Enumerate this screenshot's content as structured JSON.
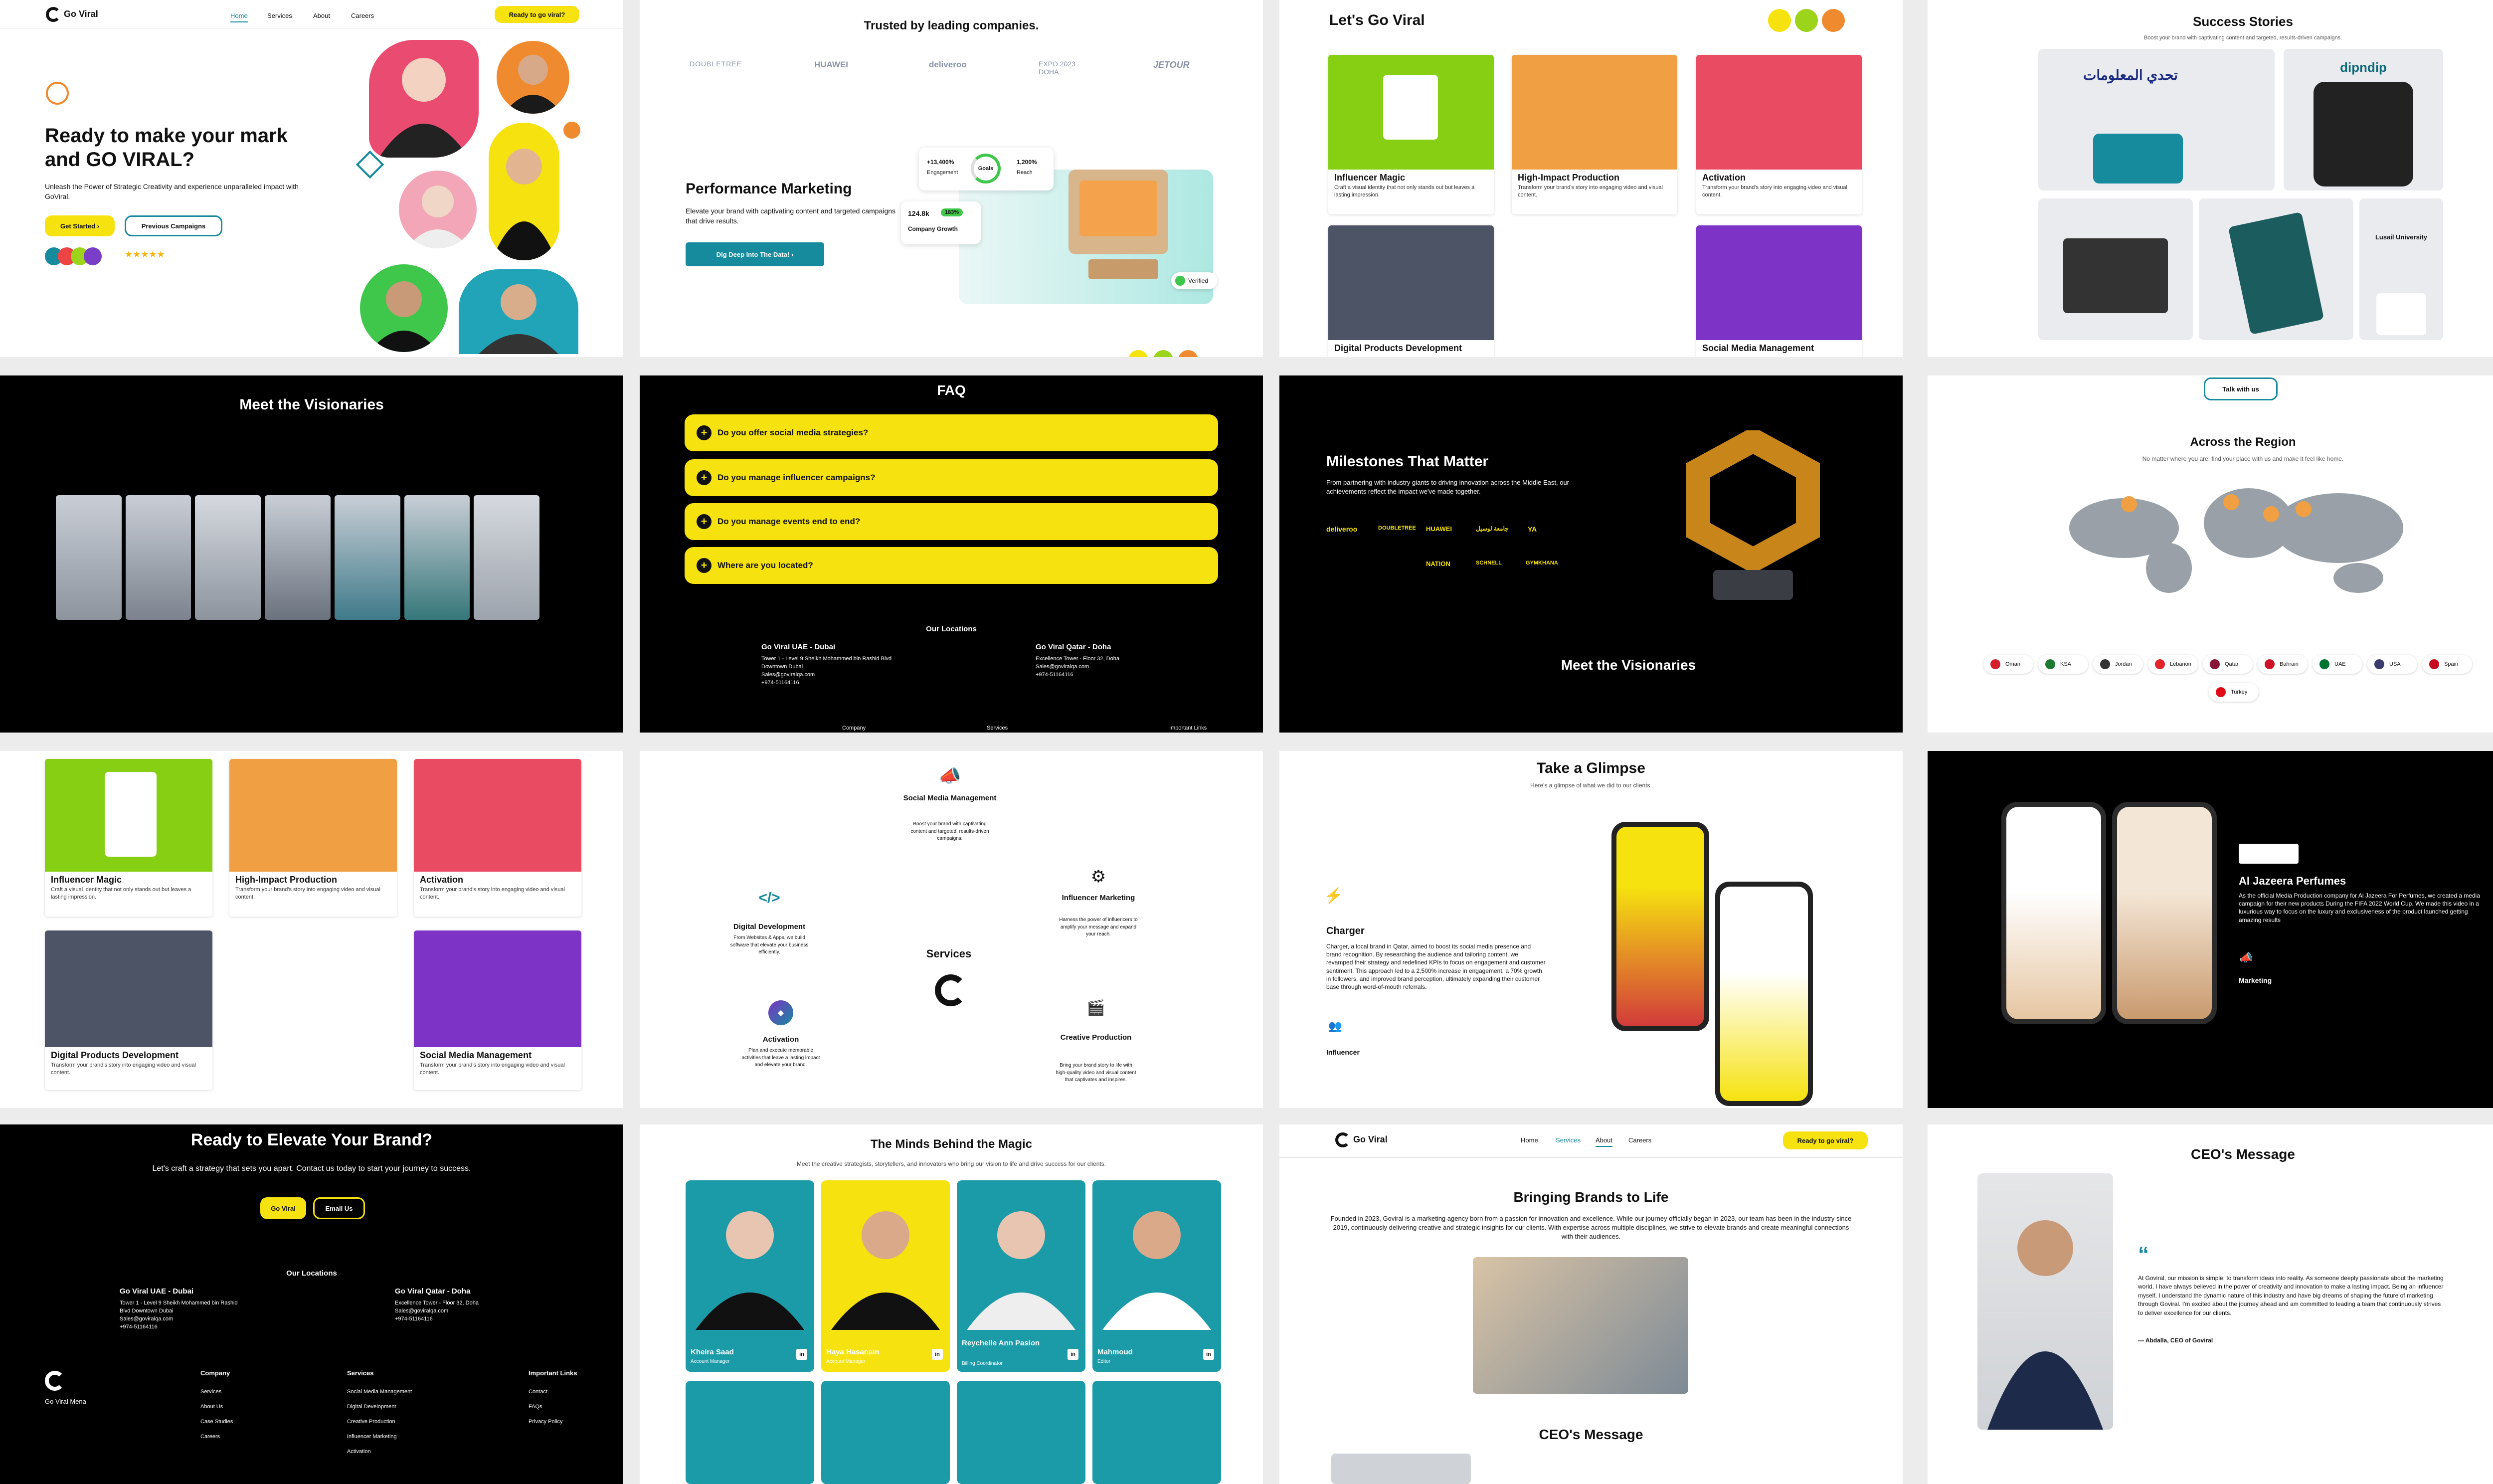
{
  "p1": {
    "brand": "Go Viral",
    "nav": [
      "Home",
      "Services",
      "About",
      "Careers"
    ],
    "cta": "Ready to go viral?",
    "h1": "Ready to make your mark and GO VIRAL?",
    "sub": "Unleash the Power of Strategic Creativity and experience unparalleled impact with GoViral.",
    "get_started": "Get Started",
    "prev": "Previous Campaigns",
    "stars": "★★★★★"
  },
  "p2": {
    "trusted": "Trusted by leading companies.",
    "logos": [
      "DOUBLETREE",
      "HUAWEI",
      "deliveroo",
      "EXPO 2023 DOHA",
      "JETOUR"
    ],
    "title": "Performance Marketing",
    "desc": "Elevate your brand with captivating content and targeted campaigns that drive results.",
    "btn": "Dig Deep Into The Data!",
    "goals": "Goals",
    "eng_val": "+13,400%",
    "eng": "Engagement",
    "reach_val": "1,200%",
    "reach": "Reach",
    "growth_val": "124.8k",
    "growth_badge": "183%",
    "growth": "Company Growth",
    "verified": "Verified"
  },
  "p3": {
    "title": "Let's Go Viral",
    "cards": [
      {
        "t": "Influencer Magic",
        "d": "Craft a visual identity that not only stands out but leaves a lasting impression."
      },
      {
        "t": "High-Impact Production",
        "d": "Transform your brand's story into engaging video and visual content."
      },
      {
        "t": "Activation",
        "d": "Transform your brand's story into engaging video and visual content."
      },
      {
        "t": "Digital Products Development",
        "d": ""
      },
      {
        "t": "Social Media Management",
        "d": ""
      }
    ]
  },
  "p4": {
    "title": "Success Stories",
    "sub": "Boost your brand with captivating content and targeted, results-driven campaigns.",
    "case1": "تحدي المعلومات",
    "case2": "dipndip",
    "case3": "Lusail University"
  },
  "p5": {
    "title": "Meet the Visionaries"
  },
  "p6": {
    "title": "FAQ",
    "q": [
      "Do you offer social media strategies?",
      "Do you manage influencer campaigns?",
      "Do you manage events end to end?",
      "Where are you located?"
    ],
    "loc": "Our Locations",
    "uae": "Go Viral UAE - Dubai",
    "uae_addr": "Tower 1 - Level 9 Sheikh Mohammed bin Rashid Blvd Downtown Dubai",
    "qat": "Go Viral Qatar - Doha",
    "qat_addr": "Excellence Tower - Floor 32, Doha",
    "email": "Sales@goviralqa.com",
    "phone": "+974-51164116",
    "f1": "Company",
    "f2": "Services",
    "f3": "Important Links"
  },
  "p7": {
    "title": "Milestones That Matter",
    "desc": "From partnering with industry giants to driving innovation across the Middle East, our achievements reflect the impact we've made together.",
    "logos": [
      "deliveroo",
      "DOUBLETREE",
      "HUAWEI",
      "جامعة لوسيل",
      "YA",
      "NATION",
      "SCHNELL",
      "GYMKHANA"
    ],
    "foot": "Meet the Visionaries"
  },
  "p8": {
    "talk": "Talk with us",
    "title": "Across the Region",
    "sub": "No matter where you are, find your place with us and make it feel like home.",
    "flags": [
      "Oman",
      "KSA",
      "Jordan",
      "Lebanon",
      "Qatar",
      "Bahrain",
      "UAE",
      "USA",
      "Spain",
      "Turkey"
    ]
  },
  "p9": {
    "cards": [
      {
        "t": "Influencer Magic",
        "d": "Craft a visual identity that not only stands out but leaves a lasting impression."
      },
      {
        "t": "High-Impact Production",
        "d": "Transform your brand's story into engaging video and visual content."
      },
      {
        "t": "Activation",
        "d": "Transform your brand's story into engaging video and visual content."
      },
      {
        "t": "Digital Products Development",
        "d": "Transform your brand's story into engaging video and visual content."
      },
      {
        "t": "Social Media Management",
        "d": "Transform your brand's story into engaging video and visual content."
      }
    ]
  },
  "p10": {
    "center": "Services",
    "items": [
      {
        "t": "Social Media Management",
        "d": "Boost your brand with captivating content and targeted, results-driven campaigns."
      },
      {
        "t": "Digital Development",
        "d": "From Websites & Apps, we build software that elevate your business efficiently."
      },
      {
        "t": "Influencer Marketing",
        "d": "Harness the power of influencers to amplify your message and expand your reach."
      },
      {
        "t": "Activation",
        "d": "Plan and execute memorable activities that leave a lasting impact and elevate your brand."
      },
      {
        "t": "Creative Production",
        "d": "Bring your brand story to life with high-quality video and visual content that captivates and inspires."
      }
    ]
  },
  "p11": {
    "title": "Take a Glimpse",
    "sub": "Here's a glimpse of what we did to our clients.",
    "brand": "Charger",
    "desc": "Charger, a local brand in Qatar, aimed to boost its social media presence and brand recognition. By researching the audience and tailoring content, we revamped their strategy and redefined KPIs to focus on engagement and customer sentiment. This approach led to a 2,500% increase in engagement, a 70% growth in followers, and improved brand perception, ultimately expanding their customer base through word-of-mouth referrals.",
    "tag": "Influencer"
  },
  "p12": {
    "title": "Al Jazeera Perfumes",
    "desc": "As the official Media Production company for Al Jazeera For Perfumes, we created a media campaign for their new products During the FIFA 2022 World Cup. We made this video in a luxurious way to focus on the luxury and exclusiveness of the product launched getting amazing results",
    "tag": "Marketing"
  },
  "p13": {
    "title": "Ready to Elevate Your Brand?",
    "sub": "Let's craft a strategy that sets you apart. Contact us today to start your journey to success.",
    "b1": "Go Viral",
    "b2": "Email Us",
    "loc": "Our Locations",
    "uae": "Go Viral UAE - Dubai",
    "uae_addr": "Tower 1 - Level 9 Sheikh Mohammed bin Rashid Blvd Downtown Dubai",
    "qat": "Go Viral Qatar - Doha",
    "qat_addr": "Excellence Tower - Floor 32, Doha",
    "email": "Sales@goviralqa.com",
    "phone": "+974-51164116",
    "brand": "Go Viral Mena",
    "cols": [
      {
        "h": "Company",
        "i": [
          "Services",
          "About Us",
          "Case Studies",
          "Careers"
        ]
      },
      {
        "h": "Services",
        "i": [
          "Social Media Management",
          "Digital Development",
          "Creative Production",
          "Influencer Marketing",
          "Activation"
        ]
      },
      {
        "h": "Important Links",
        "i": [
          "Contact",
          "FAQs",
          "Privacy Policy"
        ]
      }
    ]
  },
  "p14": {
    "title": "The Minds Behind the Magic",
    "sub": "Meet the creative strategists, storytellers, and innovators who bring our vision to life and drive success for our clients.",
    "team": [
      {
        "n": "Kheira Saad",
        "r": "Account Manager"
      },
      {
        "n": "Haya Hasanain",
        "r": "Account Manager"
      },
      {
        "n": "Reychelle Ann Pasion",
        "r": "Billing Coordinator"
      },
      {
        "n": "Mahmoud",
        "r": "Editor"
      }
    ]
  },
  "p15": {
    "brand": "Go Viral",
    "nav": [
      "Home",
      "Services",
      "About",
      "Careers"
    ],
    "cta": "Ready to go viral?",
    "title": "Bringing Brands to Life",
    "desc": "Founded in 2023, Goviral is a marketing agency born from a passion for innovation and excellence. While our journey officially began in 2023, our team has been in the industry since 2019, continuously delivering creative and strategic insights for our clients. With expertise across multiple disciplines, we strive to elevate brands and create meaningful connections with their audiences.",
    "ceo": "CEO's Message"
  },
  "p16": {
    "title": "CEO's Message",
    "quote": "At Goviral, our mission is simple: to transform ideas into reality. As someone deeply passionate about the marketing world, I have always believed in the power of creativity and innovation to make a lasting impact. Being an influencer myself, I understand the dynamic nature of this industry and have big dreams of shaping the future of marketing through Goviral. I'm excited about the journey ahead and am committed to leading a team that continuously strives to deliver excellence for our clients.",
    "sig": "— Abdalla, CEO of Goviral"
  }
}
